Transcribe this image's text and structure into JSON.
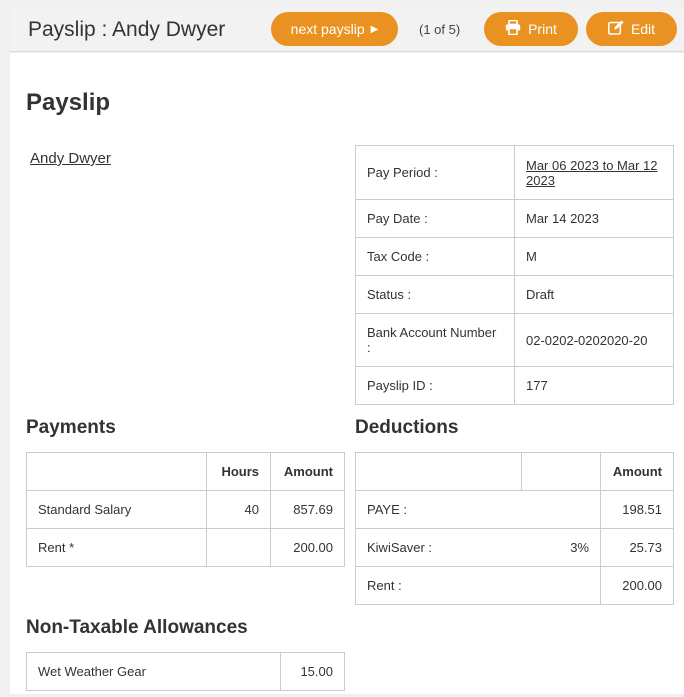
{
  "header": {
    "title": "Payslip : Andy Dwyer",
    "next_label": "next payslip",
    "counter": "(1 of 5)",
    "print_label": "Print",
    "edit_label": "Edit"
  },
  "page": {
    "title": "Payslip",
    "employee_link": "Andy Dwyer"
  },
  "info": [
    {
      "label": "Pay Period :",
      "value": "Mar 06 2023 to Mar 12 2023"
    },
    {
      "label": "Pay Date :",
      "value": "Mar 14 2023"
    },
    {
      "label": "Tax Code :",
      "value": "M"
    },
    {
      "label": "Status :",
      "value": "Draft"
    },
    {
      "label": "Bank Account Number :",
      "value": "02-0202-0202020-20"
    },
    {
      "label": "Payslip ID :",
      "value": "177"
    }
  ],
  "payments": {
    "title": "Payments",
    "headers": [
      "",
      "Hours",
      "Amount"
    ],
    "rows": [
      {
        "name": "Standard Salary",
        "hours": "40",
        "amount": "857.69"
      },
      {
        "name": "Rent *",
        "hours": "",
        "amount": "200.00"
      }
    ]
  },
  "deductions": {
    "title": "Deductions",
    "headers": [
      "",
      "",
      "Amount"
    ],
    "rows": [
      {
        "name": "PAYE :",
        "rate": "",
        "amount": "198.51"
      },
      {
        "name": "KiwiSaver :",
        "rate": "3%",
        "amount": "25.73"
      },
      {
        "name": "Rent :",
        "rate": "",
        "amount": "200.00"
      }
    ]
  },
  "allowances": {
    "title": "Non-Taxable Allowances",
    "rows": [
      {
        "name": "Wet Weather Gear",
        "amount": "15.00"
      }
    ]
  },
  "icons": {
    "next": "caret-right-icon",
    "print": "printer-icon",
    "edit": "edit-icon"
  },
  "colors": {
    "accent": "#ea9221"
  }
}
